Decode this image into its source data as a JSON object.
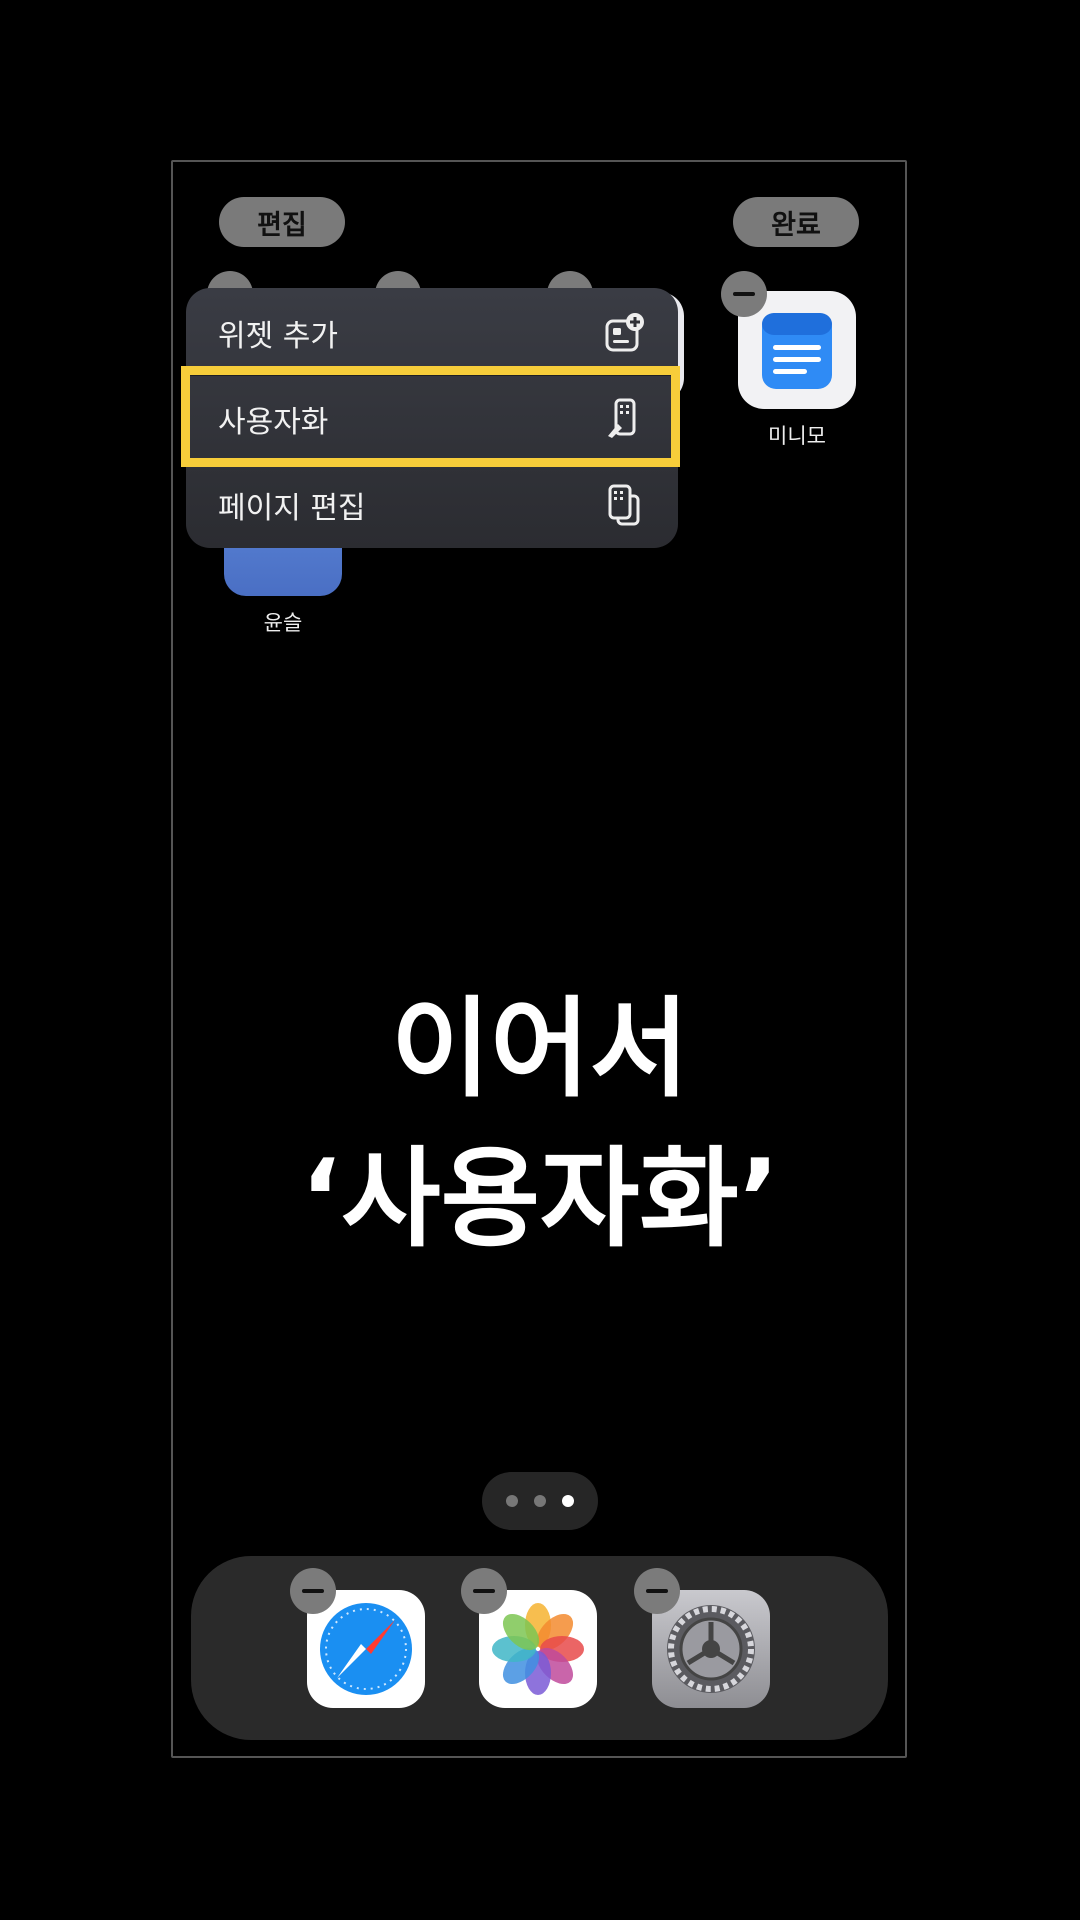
{
  "header": {
    "edit_label": "편집",
    "done_label": "완료"
  },
  "context_menu": {
    "items": [
      {
        "label": "위젯 추가",
        "icon": "widget-add-icon"
      },
      {
        "label": "사용자화",
        "icon": "customize-icon"
      },
      {
        "label": "페이지 편집",
        "icon": "edit-pages-icon"
      }
    ],
    "highlighted_index": 1,
    "highlight_color": "#f7cd3a"
  },
  "home_apps": [
    {
      "label": "미니모",
      "icon": "notes-icon"
    },
    {
      "label": "윤슬",
      "icon": "app-icon"
    }
  ],
  "caption": {
    "line1": "이어서",
    "line2": "‘사용자화’"
  },
  "page_indicator": {
    "pages": 3,
    "current": 3
  },
  "dock": {
    "apps": [
      {
        "name": "safari-icon"
      },
      {
        "name": "photos-icon"
      },
      {
        "name": "settings-icon"
      }
    ]
  }
}
